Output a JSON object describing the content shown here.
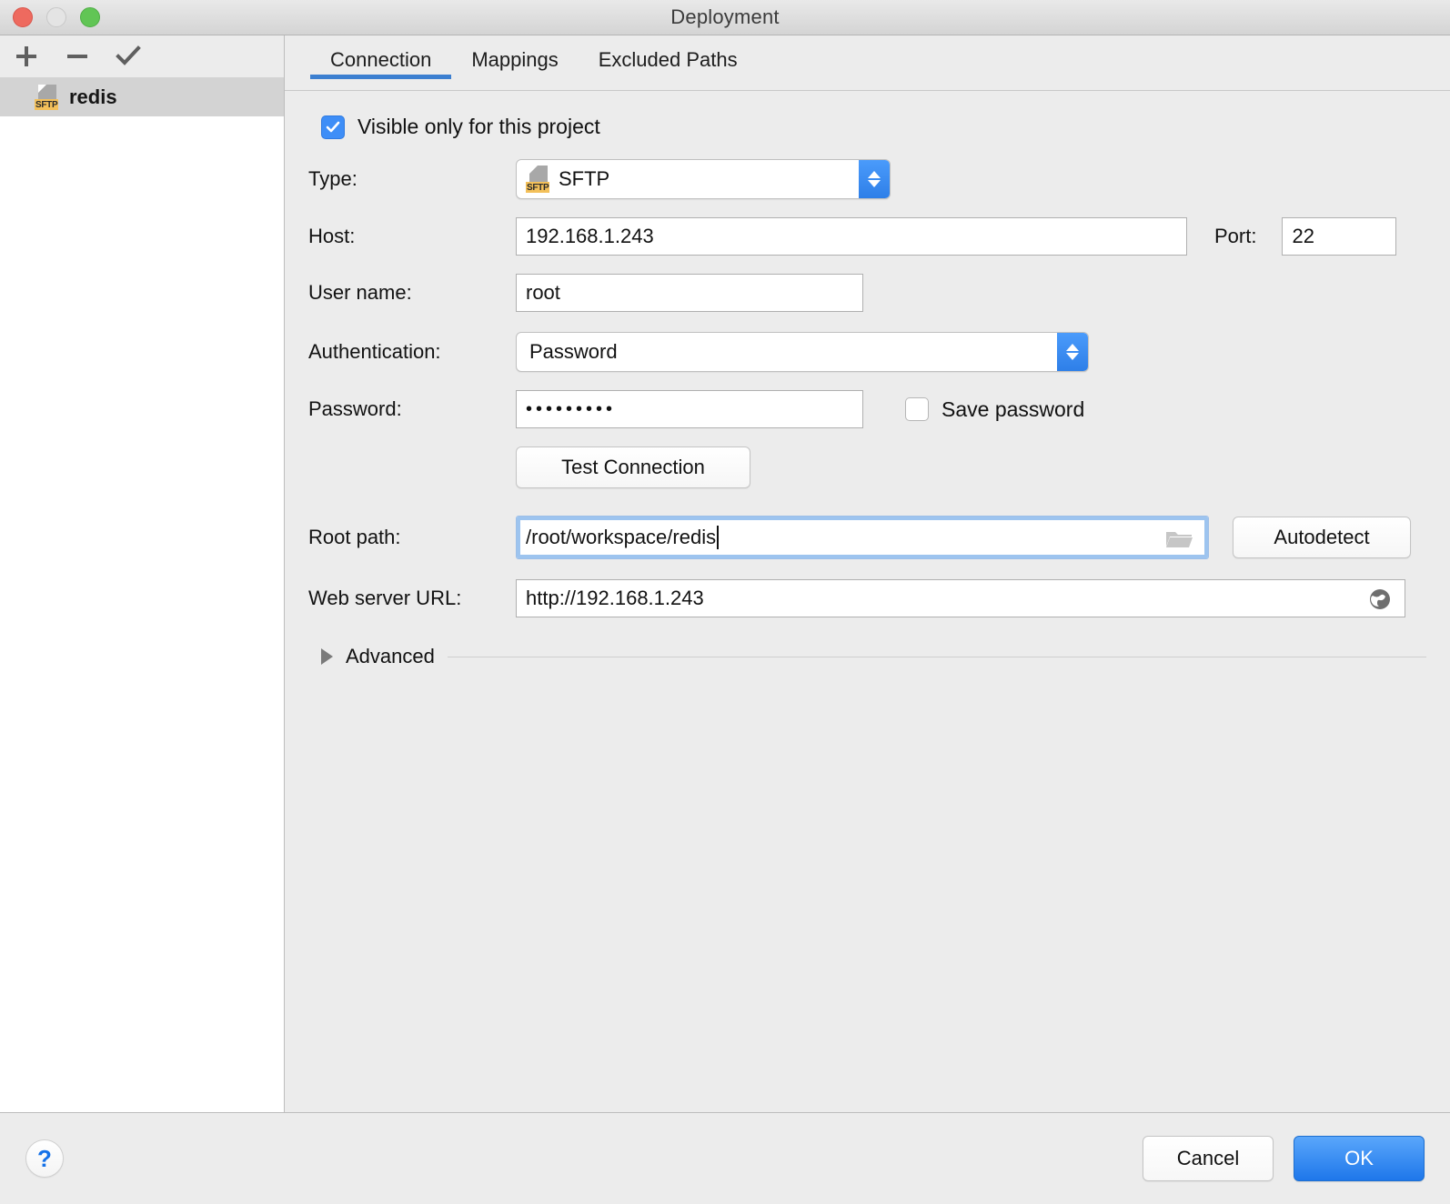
{
  "window": {
    "title": "Deployment",
    "traffic_lights": [
      "close-red",
      "minimize-gray",
      "maximize-green"
    ]
  },
  "sidebar": {
    "toolbar": [
      {
        "name": "add-button",
        "glyph": "+"
      },
      {
        "name": "remove-button",
        "glyph": "−"
      },
      {
        "name": "set-default-button",
        "glyph": "✓"
      }
    ],
    "items": [
      {
        "label": "redis",
        "icon": "sftp-file-icon",
        "badge": "SFTP",
        "selected": true
      }
    ]
  },
  "main": {
    "tabs": [
      {
        "label": "Connection",
        "active": true
      },
      {
        "label": "Mappings",
        "active": false
      },
      {
        "label": "Excluded Paths",
        "active": false
      }
    ],
    "accent_color": "#3c7fd0"
  },
  "form": {
    "visible_only_checkbox": {
      "label": "Visible only for this project",
      "checked": true
    },
    "type": {
      "label": "Type:",
      "value": "SFTP",
      "badge": "SFTP"
    },
    "host": {
      "label": "Host:",
      "value": "192.168.1.243"
    },
    "port": {
      "label": "Port:",
      "value": "22"
    },
    "username": {
      "label": "User name:",
      "value": "root"
    },
    "authentication": {
      "label": "Authentication:",
      "value": "Password"
    },
    "password": {
      "label": "Password:",
      "value": "•••••••••"
    },
    "save_password": {
      "label": "Save password",
      "checked": false
    },
    "test_connection": {
      "label": "Test Connection"
    },
    "root_path": {
      "label": "Root path:",
      "value": "/root/workspace/redis",
      "focused": true,
      "browse_icon": "folder-icon"
    },
    "autodetect": {
      "label": "Autodetect"
    },
    "web_server_url": {
      "label": "Web server URL:",
      "value": "http://192.168.1.243",
      "open_icon": "globe-icon"
    },
    "advanced": {
      "label": "Advanced",
      "expanded": false
    }
  },
  "footer": {
    "help": "?",
    "cancel": "Cancel",
    "ok": "OK"
  }
}
